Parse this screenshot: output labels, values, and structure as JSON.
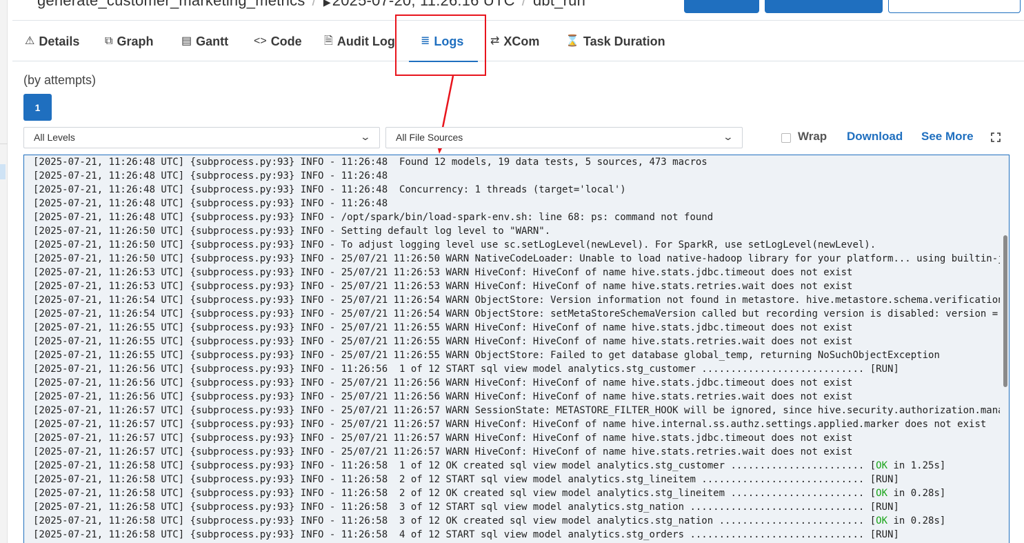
{
  "header": {
    "breadcrumb": [
      "generate_customer_marketing_metrics",
      "2025-07-20, 11:26:16 UTC",
      "dbt_run"
    ]
  },
  "tabs": [
    {
      "name": "details",
      "label": "Details",
      "icon": "⚠"
    },
    {
      "name": "graph",
      "label": "Graph",
      "icon": "⧉"
    },
    {
      "name": "gantt",
      "label": "Gantt",
      "icon": "▤"
    },
    {
      "name": "code",
      "label": "Code",
      "icon": "<>"
    },
    {
      "name": "audit-log",
      "label": "Audit Log",
      "icon": "🗎"
    },
    {
      "name": "logs",
      "label": "Logs",
      "icon": "≣",
      "active": true
    },
    {
      "name": "xcom",
      "label": "XCom",
      "icon": "⇄"
    },
    {
      "name": "task-duration",
      "label": "Task Duration",
      "icon": "⌛"
    }
  ],
  "attempts": {
    "label": "(by attempts)",
    "buttons": [
      "1"
    ]
  },
  "filters": {
    "levels": "All Levels",
    "sources": "All File Sources"
  },
  "controls": {
    "wrap": "Wrap",
    "download": "Download",
    "see_more": "See More"
  },
  "colors": {
    "accent": "#1f6fbf",
    "highlight": "#e8141c",
    "ok": "#1aa51a"
  },
  "log_lines": [
    "[2025-07-21, 11:26:48 UTC] {subprocess.py:93} INFO - 11:26:48  Found 12 models, 19 data tests, 5 sources, 473 macros",
    "[2025-07-21, 11:26:48 UTC] {subprocess.py:93} INFO - 11:26:48",
    "[2025-07-21, 11:26:48 UTC] {subprocess.py:93} INFO - 11:26:48  Concurrency: 1 threads (target='local')",
    "[2025-07-21, 11:26:48 UTC] {subprocess.py:93} INFO - 11:26:48",
    "[2025-07-21, 11:26:48 UTC] {subprocess.py:93} INFO - /opt/spark/bin/load-spark-env.sh: line 68: ps: command not found",
    "[2025-07-21, 11:26:50 UTC] {subprocess.py:93} INFO - Setting default log level to \"WARN\".",
    "[2025-07-21, 11:26:50 UTC] {subprocess.py:93} INFO - To adjust logging level use sc.setLogLevel(newLevel). For SparkR, use setLogLevel(newLevel).",
    "[2025-07-21, 11:26:50 UTC] {subprocess.py:93} INFO - 25/07/21 11:26:50 WARN NativeCodeLoader: Unable to load native-hadoop library for your platform... using builtin-j",
    "[2025-07-21, 11:26:53 UTC] {subprocess.py:93} INFO - 25/07/21 11:26:53 WARN HiveConf: HiveConf of name hive.stats.jdbc.timeout does not exist",
    "[2025-07-21, 11:26:53 UTC] {subprocess.py:93} INFO - 25/07/21 11:26:53 WARN HiveConf: HiveConf of name hive.stats.retries.wait does not exist",
    "[2025-07-21, 11:26:54 UTC] {subprocess.py:93} INFO - 25/07/21 11:26:54 WARN ObjectStore: Version information not found in metastore. hive.metastore.schema.verification",
    "[2025-07-21, 11:26:54 UTC] {subprocess.py:93} INFO - 25/07/21 11:26:54 WARN ObjectStore: setMetaStoreSchemaVersion called but recording version is disabled: version =",
    "[2025-07-21, 11:26:55 UTC] {subprocess.py:93} INFO - 25/07/21 11:26:55 WARN HiveConf: HiveConf of name hive.stats.jdbc.timeout does not exist",
    "[2025-07-21, 11:26:55 UTC] {subprocess.py:93} INFO - 25/07/21 11:26:55 WARN HiveConf: HiveConf of name hive.stats.retries.wait does not exist",
    "[2025-07-21, 11:26:55 UTC] {subprocess.py:93} INFO - 25/07/21 11:26:55 WARN ObjectStore: Failed to get database global_temp, returning NoSuchObjectException",
    "[2025-07-21, 11:26:56 UTC] {subprocess.py:93} INFO - 11:26:56  1 of 12 START sql view model analytics.stg_customer ............................ [RUN]",
    "[2025-07-21, 11:26:56 UTC] {subprocess.py:93} INFO - 25/07/21 11:26:56 WARN HiveConf: HiveConf of name hive.stats.jdbc.timeout does not exist",
    "[2025-07-21, 11:26:56 UTC] {subprocess.py:93} INFO - 25/07/21 11:26:56 WARN HiveConf: HiveConf of name hive.stats.retries.wait does not exist",
    "[2025-07-21, 11:26:57 UTC] {subprocess.py:93} INFO - 25/07/21 11:26:57 WARN SessionState: METASTORE_FILTER_HOOK will be ignored, since hive.security.authorization.mana",
    "[2025-07-21, 11:26:57 UTC] {subprocess.py:93} INFO - 25/07/21 11:26:57 WARN HiveConf: HiveConf of name hive.internal.ss.authz.settings.applied.marker does not exist",
    "[2025-07-21, 11:26:57 UTC] {subprocess.py:93} INFO - 25/07/21 11:26:57 WARN HiveConf: HiveConf of name hive.stats.jdbc.timeout does not exist",
    "[2025-07-21, 11:26:57 UTC] {subprocess.py:93} INFO - 25/07/21 11:26:57 WARN HiveConf: HiveConf of name hive.stats.retries.wait does not exist",
    "[2025-07-21, 11:26:58 UTC] {subprocess.py:93} INFO - 11:26:58  1 of 12 OK created sql view model analytics.stg_customer ....................... [OK in 1.25s]",
    "[2025-07-21, 11:26:58 UTC] {subprocess.py:93} INFO - 11:26:58  2 of 12 START sql view model analytics.stg_lineitem ............................ [RUN]",
    "[2025-07-21, 11:26:58 UTC] {subprocess.py:93} INFO - 11:26:58  2 of 12 OK created sql view model analytics.stg_lineitem ....................... [OK in 0.28s]",
    "[2025-07-21, 11:26:58 UTC] {subprocess.py:93} INFO - 11:26:58  3 of 12 START sql view model analytics.stg_nation .............................. [RUN]",
    "[2025-07-21, 11:26:58 UTC] {subprocess.py:93} INFO - 11:26:58  3 of 12 OK created sql view model analytics.stg_nation ......................... [OK in 0.28s]",
    "[2025-07-21, 11:26:58 UTC] {subprocess.py:93} INFO - 11:26:58  4 of 12 START sql view model analytics.stg_orders .............................. [RUN]"
  ]
}
